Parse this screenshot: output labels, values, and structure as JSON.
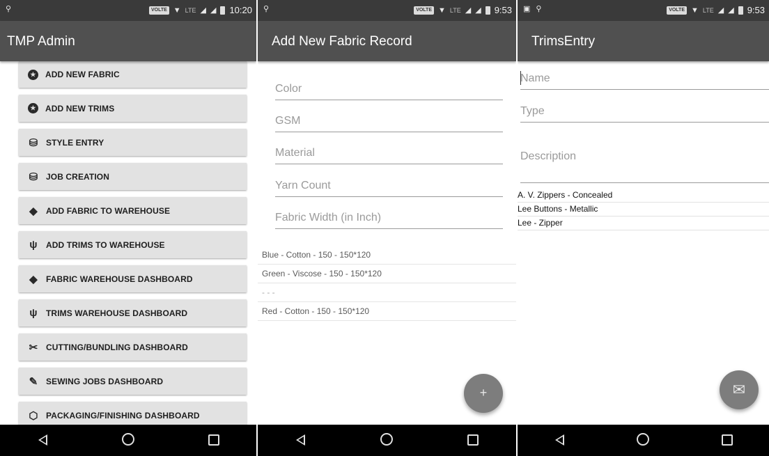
{
  "screens": [
    {
      "status": {
        "time": "10:20",
        "network": "LTE",
        "volte": "VOLTE"
      },
      "title": "TMP Admin",
      "menu": [
        {
          "label": "ADD NEW FABRIC",
          "icon": "star-circle-icon"
        },
        {
          "label": "ADD NEW TRIMS",
          "icon": "star-circle-icon"
        },
        {
          "label": "STYLE ENTRY",
          "icon": "database-plus-icon"
        },
        {
          "label": "JOB CREATION",
          "icon": "database-plus-icon"
        },
        {
          "label": "ADD FABRIC TO WAREHOUSE",
          "icon": "dropbox-icon"
        },
        {
          "label": "ADD TRIMS TO WAREHOUSE",
          "icon": "usb-icon"
        },
        {
          "label": "FABRIC WAREHOUSE DASHBOARD",
          "icon": "dropbox-icon"
        },
        {
          "label": "TRIMS WAREHOUSE DASHBOARD",
          "icon": "usb-icon"
        },
        {
          "label": "CUTTING/BUNDLING DASHBOARD",
          "icon": "scissors-icon"
        },
        {
          "label": "SEWING JOBS DASHBOARD",
          "icon": "needle-icon"
        },
        {
          "label": "PACKAGING/FINISHING DASHBOARD",
          "icon": "package-icon"
        }
      ]
    },
    {
      "status": {
        "time": "9:53",
        "network": "LTE",
        "volte": "VOLTE"
      },
      "title": "Add New Fabric Record",
      "fields": [
        {
          "placeholder": "Color"
        },
        {
          "placeholder": "GSM"
        },
        {
          "placeholder": "Material"
        },
        {
          "placeholder": "Yarn Count"
        },
        {
          "placeholder": "Fabric Width (in Inch)"
        }
      ],
      "records": [
        "Blue - Cotton - 150 - 150*120",
        "Green - Viscose - 150 - 150*120",
        "- - -",
        "Red - Cotton - 150 - 150*120"
      ],
      "fab_icon": "plus-icon"
    },
    {
      "status": {
        "time": "9:53",
        "network": "LTE",
        "volte": "VOLTE"
      },
      "title": "TrimsEntry",
      "fields": [
        {
          "placeholder": "Name"
        },
        {
          "placeholder": "Type"
        },
        {
          "placeholder": "Description"
        }
      ],
      "trims": [
        "A. V. Zippers - Concealed",
        "Lee Buttons - Metallic",
        "Lee - Zipper"
      ],
      "fab_icon": "mail-icon"
    }
  ],
  "colors": {
    "appbar": "#505050",
    "statusbar": "#3a3a3a",
    "navbar": "#000000",
    "menu_button": "#e2e2e2",
    "fab": "#7d7d7d"
  }
}
